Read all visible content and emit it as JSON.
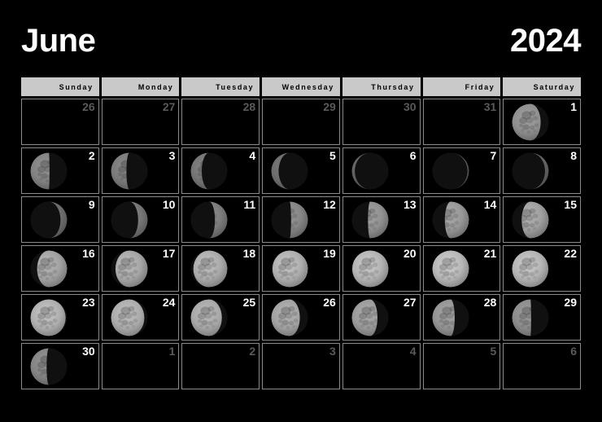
{
  "header": {
    "month": "June",
    "year": "2024"
  },
  "weekdays": [
    "Sunday",
    "Monday",
    "Tuesday",
    "Wednesday",
    "Thursday",
    "Friday",
    "Saturday"
  ],
  "colors": {
    "background": "#000000",
    "weekday_bar": "#c9c9c9",
    "weekday_text": "#000000",
    "cell_border": "#8a8a8a",
    "day_number": "#ffffff",
    "day_number_out_of_month": "#5a5a5a",
    "moon_lit": "#b4b4b4",
    "moon_dark": "#0d0d0d"
  },
  "weeks": [
    [
      {
        "day": "26",
        "in_month": false,
        "moon": null
      },
      {
        "day": "27",
        "in_month": false,
        "moon": null
      },
      {
        "day": "28",
        "in_month": false,
        "moon": null
      },
      {
        "day": "29",
        "in_month": false,
        "moon": null
      },
      {
        "day": "30",
        "in_month": false,
        "moon": null
      },
      {
        "day": "31",
        "in_month": false,
        "moon": null
      },
      {
        "day": "1",
        "in_month": true,
        "moon": {
          "phase": "waning-gibbous",
          "illumination": 0.78,
          "waxing": false,
          "brightness": 0.62
        }
      }
    ],
    [
      {
        "day": "2",
        "in_month": true,
        "moon": {
          "phase": "waning-crescent",
          "illumination": 0.52,
          "waxing": false,
          "brightness": 0.52
        }
      },
      {
        "day": "3",
        "in_month": true,
        "moon": {
          "phase": "waning-crescent",
          "illumination": 0.42,
          "waxing": false,
          "brightness": 0.46
        }
      },
      {
        "day": "4",
        "in_month": true,
        "moon": {
          "phase": "waning-crescent",
          "illumination": 0.3,
          "waxing": false,
          "brightness": 0.4
        }
      },
      {
        "day": "5",
        "in_month": true,
        "moon": {
          "phase": "waning-crescent",
          "illumination": 0.2,
          "waxing": false,
          "brightness": 0.34
        }
      },
      {
        "day": "6",
        "in_month": true,
        "moon": {
          "phase": "new-moon",
          "illumination": 0.08,
          "waxing": false,
          "brightness": 0.26
        }
      },
      {
        "day": "7",
        "in_month": true,
        "moon": {
          "phase": "new-moon",
          "illumination": 0.04,
          "waxing": true,
          "brightness": 0.24
        }
      },
      {
        "day": "8",
        "in_month": true,
        "moon": {
          "phase": "waxing-crescent",
          "illumination": 0.1,
          "waxing": true,
          "brightness": 0.3
        }
      }
    ],
    [
      {
        "day": "9",
        "in_month": true,
        "moon": {
          "phase": "waxing-crescent",
          "illumination": 0.18,
          "waxing": true,
          "brightness": 0.36
        }
      },
      {
        "day": "10",
        "in_month": true,
        "moon": {
          "phase": "waxing-crescent",
          "illumination": 0.26,
          "waxing": true,
          "brightness": 0.42
        }
      },
      {
        "day": "11",
        "in_month": true,
        "moon": {
          "phase": "waxing-crescent",
          "illumination": 0.34,
          "waxing": true,
          "brightness": 0.48
        }
      },
      {
        "day": "12",
        "in_month": true,
        "moon": {
          "phase": "first-quarter",
          "illumination": 0.46,
          "waxing": true,
          "brightness": 0.56
        }
      },
      {
        "day": "13",
        "in_month": true,
        "moon": {
          "phase": "first-quarter",
          "illumination": 0.56,
          "waxing": true,
          "brightness": 0.66
        }
      },
      {
        "day": "14",
        "in_month": true,
        "moon": {
          "phase": "waxing-gibbous",
          "illumination": 0.66,
          "waxing": true,
          "brightness": 0.72
        }
      },
      {
        "day": "15",
        "in_month": true,
        "moon": {
          "phase": "waxing-gibbous",
          "illumination": 0.74,
          "waxing": true,
          "brightness": 0.78
        }
      }
    ],
    [
      {
        "day": "16",
        "in_month": true,
        "moon": {
          "phase": "waxing-gibbous",
          "illumination": 0.82,
          "waxing": true,
          "brightness": 0.82
        }
      },
      {
        "day": "17",
        "in_month": true,
        "moon": {
          "phase": "waxing-gibbous",
          "illumination": 0.88,
          "waxing": true,
          "brightness": 0.86
        }
      },
      {
        "day": "18",
        "in_month": true,
        "moon": {
          "phase": "waxing-gibbous",
          "illumination": 0.93,
          "waxing": true,
          "brightness": 0.9
        }
      },
      {
        "day": "19",
        "in_month": true,
        "moon": {
          "phase": "waxing-gibbous",
          "illumination": 0.97,
          "waxing": true,
          "brightness": 0.94
        }
      },
      {
        "day": "20",
        "in_month": true,
        "moon": {
          "phase": "full-moon",
          "illumination": 0.99,
          "waxing": true,
          "brightness": 0.98
        }
      },
      {
        "day": "21",
        "in_month": true,
        "moon": {
          "phase": "full-moon",
          "illumination": 1.0,
          "waxing": false,
          "brightness": 1.0
        }
      },
      {
        "day": "22",
        "in_month": true,
        "moon": {
          "phase": "full-moon",
          "illumination": 0.99,
          "waxing": false,
          "brightness": 0.98
        }
      }
    ],
    [
      {
        "day": "23",
        "in_month": true,
        "moon": {
          "phase": "waning-gibbous",
          "illumination": 0.96,
          "waxing": false,
          "brightness": 0.94
        }
      },
      {
        "day": "24",
        "in_month": true,
        "moon": {
          "phase": "waning-gibbous",
          "illumination": 0.91,
          "waxing": false,
          "brightness": 0.9
        }
      },
      {
        "day": "25",
        "in_month": true,
        "moon": {
          "phase": "waning-gibbous",
          "illumination": 0.85,
          "waxing": false,
          "brightness": 0.86
        }
      },
      {
        "day": "26",
        "in_month": true,
        "moon": {
          "phase": "waning-gibbous",
          "illumination": 0.78,
          "waxing": false,
          "brightness": 0.8
        }
      },
      {
        "day": "27",
        "in_month": true,
        "moon": {
          "phase": "waning-gibbous",
          "illumination": 0.7,
          "waxing": false,
          "brightness": 0.74
        }
      },
      {
        "day": "28",
        "in_month": true,
        "moon": {
          "phase": "waning-gibbous",
          "illumination": 0.61,
          "waxing": false,
          "brightness": 0.68
        }
      },
      {
        "day": "29",
        "in_month": true,
        "moon": {
          "phase": "last-quarter",
          "illumination": 0.52,
          "waxing": false,
          "brightness": 0.6
        }
      }
    ],
    [
      {
        "day": "30",
        "in_month": true,
        "moon": {
          "phase": "last-quarter",
          "illumination": 0.44,
          "waxing": false,
          "brightness": 0.54
        }
      },
      {
        "day": "1",
        "in_month": false,
        "moon": null
      },
      {
        "day": "2",
        "in_month": false,
        "moon": null
      },
      {
        "day": "3",
        "in_month": false,
        "moon": null
      },
      {
        "day": "4",
        "in_month": false,
        "moon": null
      },
      {
        "day": "5",
        "in_month": false,
        "moon": null
      },
      {
        "day": "6",
        "in_month": false,
        "moon": null
      }
    ]
  ]
}
